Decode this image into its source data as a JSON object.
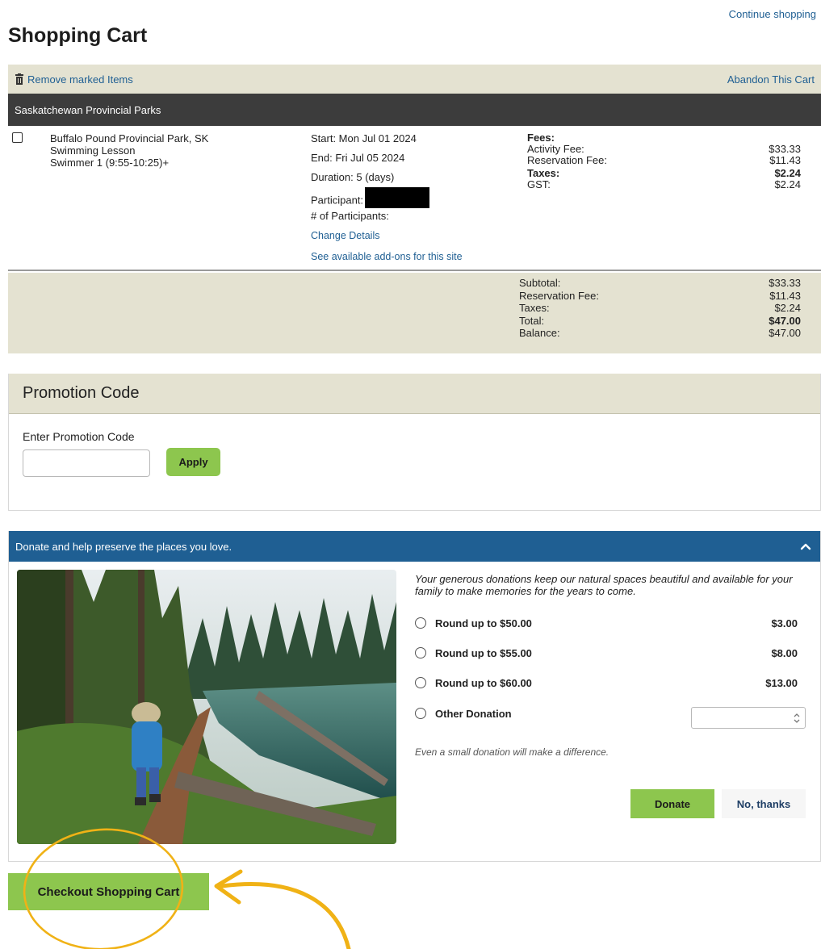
{
  "header": {
    "continue_link": "Continue shopping",
    "title": "Shopping Cart"
  },
  "action_bar": {
    "remove_label": "Remove marked Items",
    "abandon_label": "Abandon This Cart",
    "remove_icon": "trash-icon"
  },
  "section": {
    "title": "Saskatchewan Provincial Parks"
  },
  "cart_item": {
    "park": "Buffalo Pound Provincial Park, SK",
    "activity": "Swimming Lesson",
    "session": "Swimmer 1 (9:55-10:25)+",
    "start": "Start: Mon Jul 01 2024",
    "end": "End: Fri Jul 05 2024",
    "duration": "Duration: 5 (days)",
    "participant_label": "Participant:",
    "num_participants_label": "# of Participants:",
    "change_details": "Change Details",
    "addons_link": "See available add-ons for this site",
    "fees": {
      "heading": "Fees:",
      "activity_fee_label": "Activity Fee:",
      "activity_fee": "$33.33",
      "reservation_fee_label": "Reservation Fee:",
      "reservation_fee": "$11.43",
      "taxes_label": "Taxes:",
      "taxes": "$2.24",
      "gst_label": "GST:",
      "gst": "$2.24"
    }
  },
  "summary": {
    "subtotal_label": "Subtotal:",
    "subtotal": "$33.33",
    "reservation_fee_label": "Reservation Fee:",
    "reservation_fee": "$11.43",
    "taxes_label": "Taxes:",
    "taxes": "$2.24",
    "total_label": "Total:",
    "total": "$47.00",
    "balance_label": "Balance:",
    "balance": "$47.00"
  },
  "promo": {
    "heading": "Promotion Code",
    "label": "Enter Promotion Code",
    "value": "",
    "apply": "Apply"
  },
  "donation": {
    "heading": "Donate and help preserve the places you love.",
    "copy": "Your generous donations keep our natural spaces beautiful and available for your family to make memories for the years to come.",
    "options": [
      {
        "label": "Round up to $50.00",
        "amount": "$3.00"
      },
      {
        "label": "Round up to $55.00",
        "amount": "$8.00"
      },
      {
        "label": "Round up to $60.00",
        "amount": "$13.00"
      },
      {
        "label": "Other Donation",
        "amount": ""
      }
    ],
    "note": "Even a small donation will make a difference.",
    "donate": "Donate",
    "no_thanks": "No, thanks"
  },
  "checkout": {
    "label": "Checkout Shopping Cart"
  },
  "colors": {
    "accent_green": "#8dc64e",
    "header_blue": "#1f5f93",
    "tan": "#e4e2d1",
    "dark_bar": "#3c3c3c",
    "annotation_yellow": "#f0b216"
  }
}
